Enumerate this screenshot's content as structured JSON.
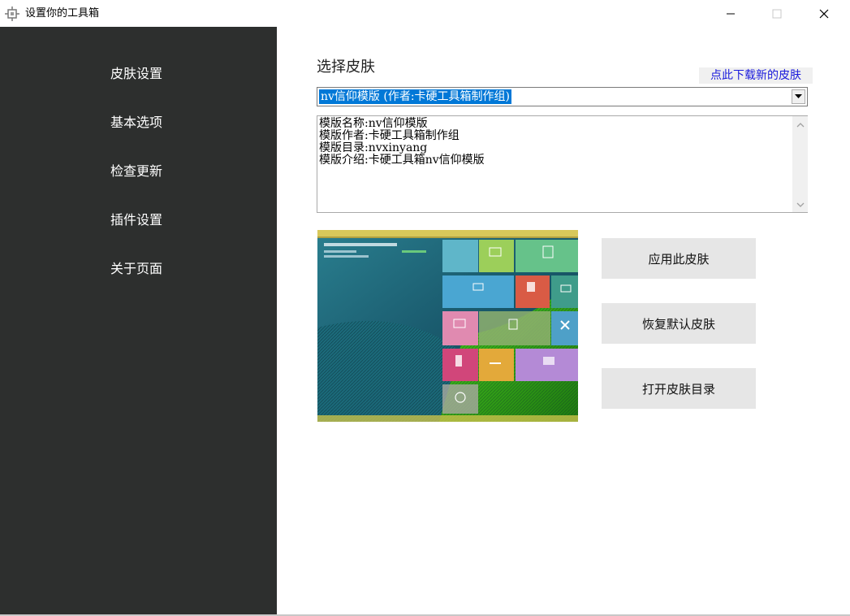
{
  "window": {
    "title": "设置你的工具箱",
    "icon": "toolbox-gear-icon"
  },
  "sidebar": {
    "items": [
      {
        "label": "皮肤设置"
      },
      {
        "label": "基本选项"
      },
      {
        "label": "检查更新"
      },
      {
        "label": "插件设置"
      },
      {
        "label": "关于页面"
      }
    ]
  },
  "main": {
    "section_title": "选择皮肤",
    "download_link": "点此下载新的皮肤",
    "skin_select": {
      "selected": "nv信仰模版 (作者:卡硬工具箱制作组)"
    },
    "skin_info": {
      "lines": [
        "模版名称:nv信仰模版",
        "模版作者:卡硬工具箱制作组",
        "模版目录:nvxinyang",
        "模版介绍:卡硬工具箱nv信仰模版"
      ]
    },
    "buttons": {
      "apply": "应用此皮肤",
      "restore": "恢复默认皮肤",
      "open_dir": "打开皮肤目录"
    }
  },
  "colors": {
    "sidebar_bg": "#2d2f2e",
    "sidebar_text": "#ffffff",
    "link": "#1a1adc",
    "selection": "#0078d7",
    "button_bg": "#e6e6e6"
  }
}
